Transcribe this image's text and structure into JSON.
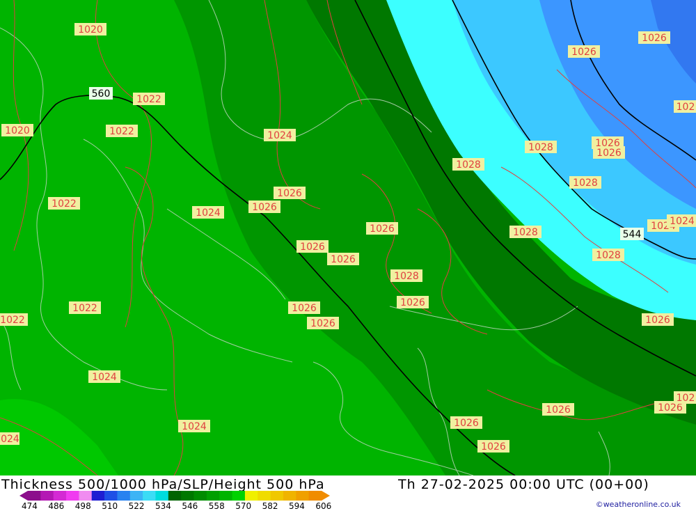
{
  "title": {
    "left": "Thickness 500/1000 hPa/SLP/Height 500 hPa",
    "right": "Th 27-02-2025 00:00 UTC (00+00)"
  },
  "credit": "©weatheronline.co.uk",
  "colorbar": {
    "ticks": [
      "474",
      "486",
      "498",
      "510",
      "522",
      "534",
      "546",
      "558",
      "570",
      "582",
      "594",
      "606"
    ],
    "colors": [
      "#8c0f8c",
      "#b418b4",
      "#d42ad4",
      "#f03cf0",
      "#f08cf0",
      "#1e1ed2",
      "#1e50e6",
      "#2882f0",
      "#3cb4f5",
      "#3cdcf5",
      "#00dcdc",
      "#006400",
      "#007800",
      "#008c00",
      "#00a000",
      "#00b400",
      "#00d200",
      "#f0f000",
      "#f0dc00",
      "#f0c800",
      "#f0b400",
      "#f0a000",
      "#f08c00"
    ]
  },
  "map": {
    "colors": {
      "green_light": "#00c800",
      "green_mid": "#00b400",
      "green_dark": "#009600",
      "green_darkest": "#007800",
      "cyan": "#3cffff",
      "blue_light": "#3cc8ff",
      "blue_mid": "#3c96ff",
      "blue_dark": "#3278f0",
      "isobar": "#e04040",
      "label_bg": "#f0f0a0"
    },
    "height_labels": [
      {
        "id": "h560",
        "text": "560"
      },
      {
        "id": "h544",
        "text": "544"
      }
    ],
    "pressure_labels": [
      {
        "id": "p1",
        "text": "1020"
      },
      {
        "id": "p2",
        "text": "1022"
      },
      {
        "id": "p3",
        "text": "1020"
      },
      {
        "id": "p4",
        "text": "1022"
      },
      {
        "id": "p5",
        "text": "1024"
      },
      {
        "id": "p6",
        "text": "1022"
      },
      {
        "id": "p7",
        "text": "1024"
      },
      {
        "id": "p8",
        "text": "1026"
      },
      {
        "id": "p9",
        "text": "1026"
      },
      {
        "id": "p10",
        "text": "1026"
      },
      {
        "id": "p11",
        "text": "1026"
      },
      {
        "id": "p12",
        "text": "1026"
      },
      {
        "id": "p13",
        "text": "1028"
      },
      {
        "id": "p14",
        "text": "1026"
      },
      {
        "id": "p15",
        "text": "1022"
      },
      {
        "id": "p16",
        "text": "1022"
      },
      {
        "id": "p17",
        "text": "1026"
      },
      {
        "id": "p18",
        "text": "1026"
      },
      {
        "id": "p19",
        "text": "1024"
      },
      {
        "id": "p20",
        "text": "1024"
      },
      {
        "id": "p21",
        "text": "1024"
      },
      {
        "id": "p22",
        "text": "1026"
      },
      {
        "id": "p23",
        "text": "1026"
      },
      {
        "id": "p24",
        "text": "1028"
      },
      {
        "id": "p25",
        "text": "1028"
      },
      {
        "id": "p26",
        "text": "1028"
      },
      {
        "id": "p27",
        "text": "1026"
      },
      {
        "id": "p28",
        "text": "1026"
      },
      {
        "id": "p29",
        "text": "1026"
      },
      {
        "id": "p30",
        "text": "1026"
      },
      {
        "id": "p31",
        "text": "1028"
      },
      {
        "id": "p32",
        "text": "1028"
      },
      {
        "id": "p33",
        "text": "1024"
      },
      {
        "id": "p34",
        "text": "1024"
      },
      {
        "id": "p35",
        "text": "1026"
      },
      {
        "id": "p36",
        "text": "1026"
      },
      {
        "id": "p37",
        "text": "1026"
      },
      {
        "id": "p38",
        "text": "1026"
      },
      {
        "id": "p39",
        "text": "102"
      },
      {
        "id": "p40",
        "text": "102"
      }
    ]
  }
}
